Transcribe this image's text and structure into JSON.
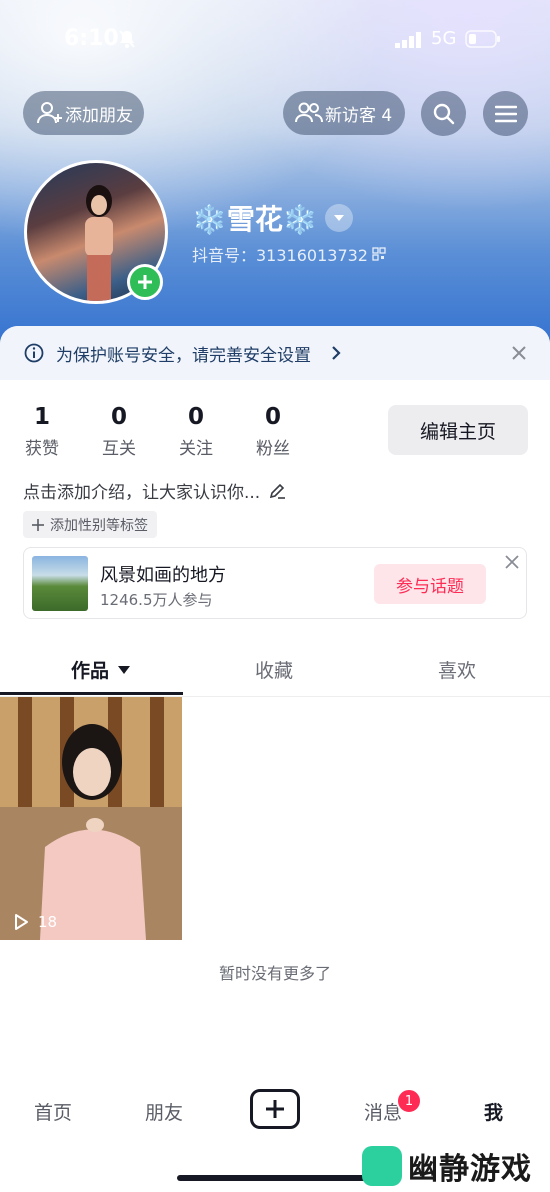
{
  "status_bar": {
    "time": "6:10",
    "network": "5G"
  },
  "header": {
    "add_friend_label": "添加朋友",
    "new_visitors_label": "新访客 4"
  },
  "profile": {
    "nickname": "❄️雪花❄️",
    "douyin_id": "抖音号：31316013732"
  },
  "notice": {
    "text": "为保护账号安全，请完善安全设置"
  },
  "stats": [
    {
      "value": "1",
      "label": "获赞"
    },
    {
      "value": "0",
      "label": "互关"
    },
    {
      "value": "0",
      "label": "关注"
    },
    {
      "value": "0",
      "label": "粉丝"
    }
  ],
  "edit_profile_label": "编辑主页",
  "bio_placeholder": "点击添加介绍，让大家认识你...",
  "tag_chip_label": "添加性别等标签",
  "topic": {
    "title": "风景如画的地方",
    "participants": "1246.5万人参与",
    "join_label": "参与话题"
  },
  "tabs": [
    {
      "label": "作品"
    },
    {
      "label": "收藏"
    },
    {
      "label": "喜欢"
    }
  ],
  "video": {
    "play_count": "18"
  },
  "no_more_text": "暂时没有更多了",
  "bottom_nav": {
    "home": "首页",
    "friends": "朋友",
    "messages": "消息",
    "me": "我",
    "messages_badge": "1"
  },
  "watermark": {
    "text": "幽静游戏"
  },
  "colors": {
    "accent": "#fe2c55",
    "add_badge": "#2ebd57",
    "hero_blue": "#2f6fd0"
  }
}
